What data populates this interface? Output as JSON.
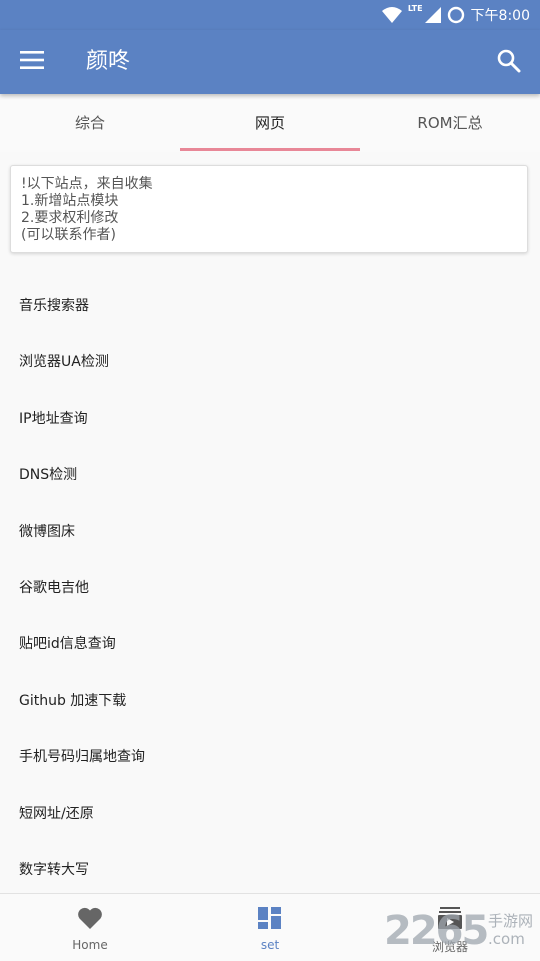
{
  "status_bar": {
    "time": "下午8:00",
    "network": "LTE"
  },
  "app_bar": {
    "title": "颜咚",
    "menu_icon": "menu-icon",
    "search_icon": "search-icon",
    "color": "#5b82c3"
  },
  "tabs": [
    {
      "label": "综合",
      "active": false
    },
    {
      "label": "网页",
      "active": true
    },
    {
      "label": "ROM汇总",
      "active": false
    }
  ],
  "tab_indicator_color": "#e88797",
  "notice": {
    "lines": [
      "!以下站点，来自收集",
      "1.新增站点模块",
      "2.要求权利修改",
      "(可以联系作者)"
    ]
  },
  "list": [
    "音乐搜索器",
    "浏览器UA检测",
    "IP地址查询",
    "DNS检测",
    "微博图床",
    "谷歌电吉他",
    "贴吧id信息查询",
    "Github 加速下载",
    "手机号码归属地查询",
    "短网址/还原",
    "数字转大写"
  ],
  "bottom_nav": [
    {
      "label": "Home",
      "icon": "heart-icon",
      "active": false
    },
    {
      "label": "set",
      "icon": "dashboard-icon",
      "active": true
    },
    {
      "label": "浏览器",
      "icon": "video-icon",
      "active": false
    }
  ],
  "watermark": {
    "digits": "2265",
    "line1": "手游网",
    "line2": ".com"
  }
}
